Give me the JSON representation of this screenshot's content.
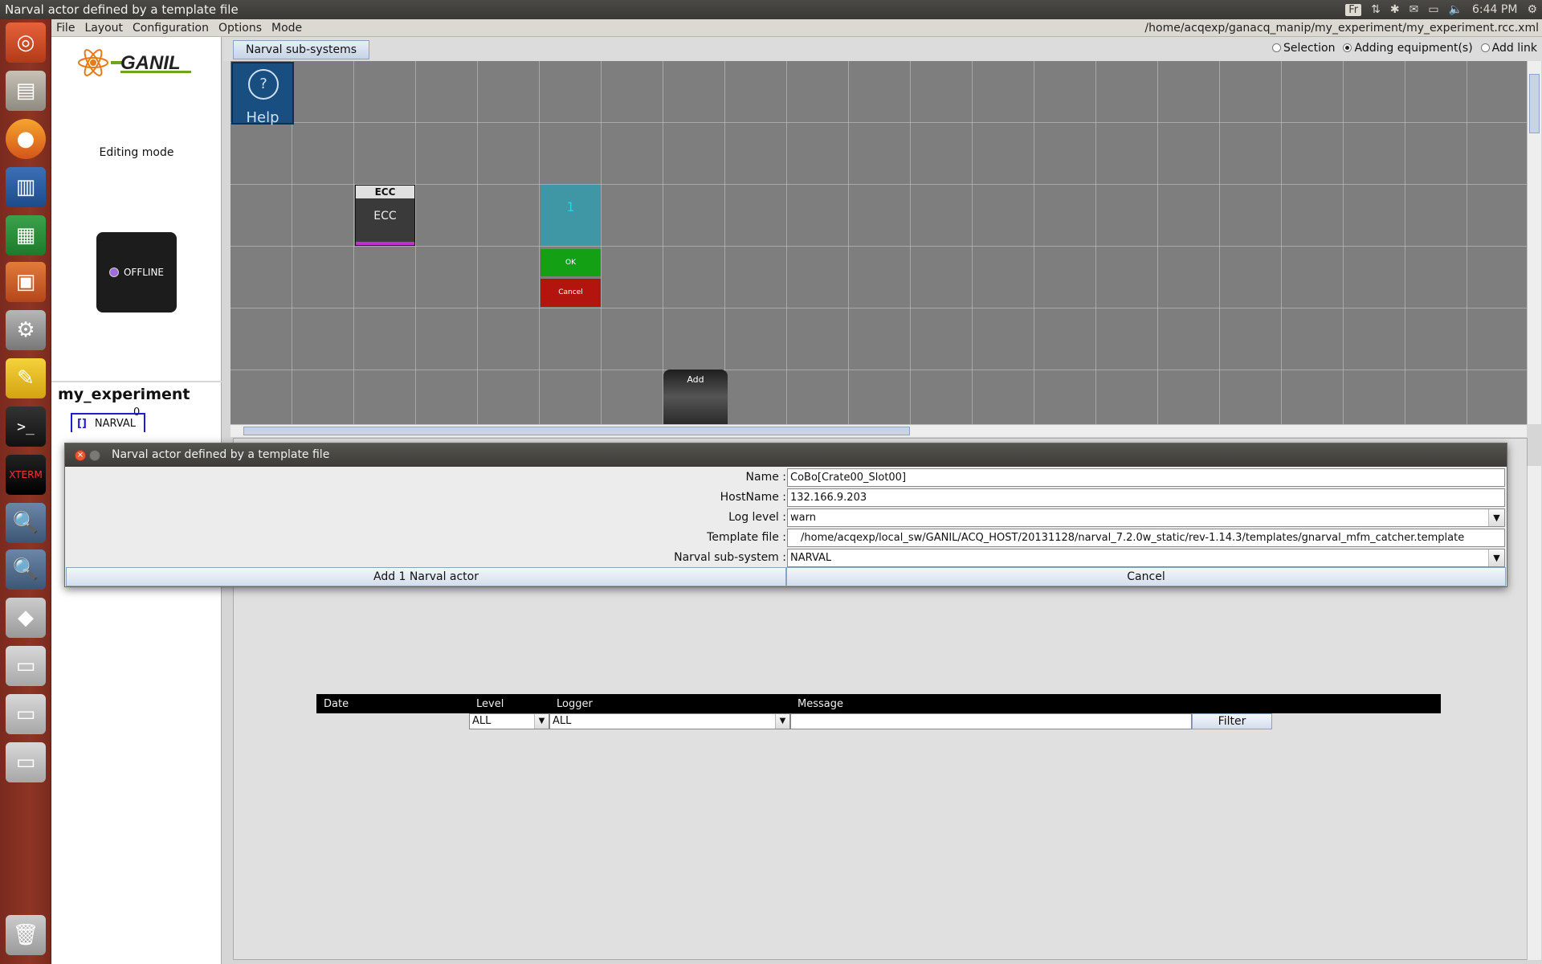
{
  "topbar": {
    "title": "Narval actor defined by a template file",
    "keyboard": "Fr",
    "time": "6:44 PM"
  },
  "menu": {
    "items": [
      "File",
      "Layout",
      "Configuration",
      "Options",
      "Mode"
    ],
    "filepath": "/home/acqexp/ganacq_manip/my_experiment/my_experiment.rcc.xml"
  },
  "left": {
    "logo_text": "GANIL",
    "editing_mode": "Editing mode",
    "status": "OFFLINE",
    "status_color": "#a06ae0",
    "experiment": "my_experiment",
    "tree_count": "0",
    "tree_item": "NARVAL",
    "tree_item_marker": "[]"
  },
  "tabs": {
    "active": "Narval sub-systems"
  },
  "modes": {
    "selection": "Selection",
    "adding": "Adding equipment(s)",
    "add_link": "Add link",
    "selected": "adding"
  },
  "canvas": {
    "help_symbol": "?",
    "help_label": "Help",
    "ecc_header": "ECC",
    "ecc_body": "ECC",
    "new_actor_count": "1",
    "ok": "OK",
    "cancel": "Cancel",
    "add": "Add"
  },
  "log": {
    "columns": [
      "Date",
      "Level",
      "Logger",
      "Message"
    ],
    "level_filter": "ALL",
    "logger_filter": "ALL",
    "message_filter": "",
    "filter_button": "Filter"
  },
  "dialog": {
    "title": "Narval actor defined by a template file",
    "fields": {
      "name_label": "Name :",
      "name_value": "CoBo[Crate00_Slot00]",
      "host_label": "HostName :",
      "host_value": "132.166.9.203",
      "log_label": "Log level :",
      "log_value": "warn",
      "template_label": "Template file :",
      "template_value": "/home/acqexp/local_sw/GANIL/ACQ_HOST/20131128/narval_7.2.0w_static/rev-1.14.3/templates/gnarval_mfm_catcher.template",
      "subsystem_label": "Narval sub-system :",
      "subsystem_value": "NARVAL"
    },
    "add_button": "Add 1 Narval actor",
    "cancel_button": "Cancel"
  },
  "colors": {
    "launcher": "#8e3524",
    "canvas": "#7e7e7e",
    "help": "#184e80",
    "new_actor": "#3f96a4",
    "ok": "#14a014",
    "cancel": "#b4140e",
    "ecc_bar": "#c030d0"
  }
}
